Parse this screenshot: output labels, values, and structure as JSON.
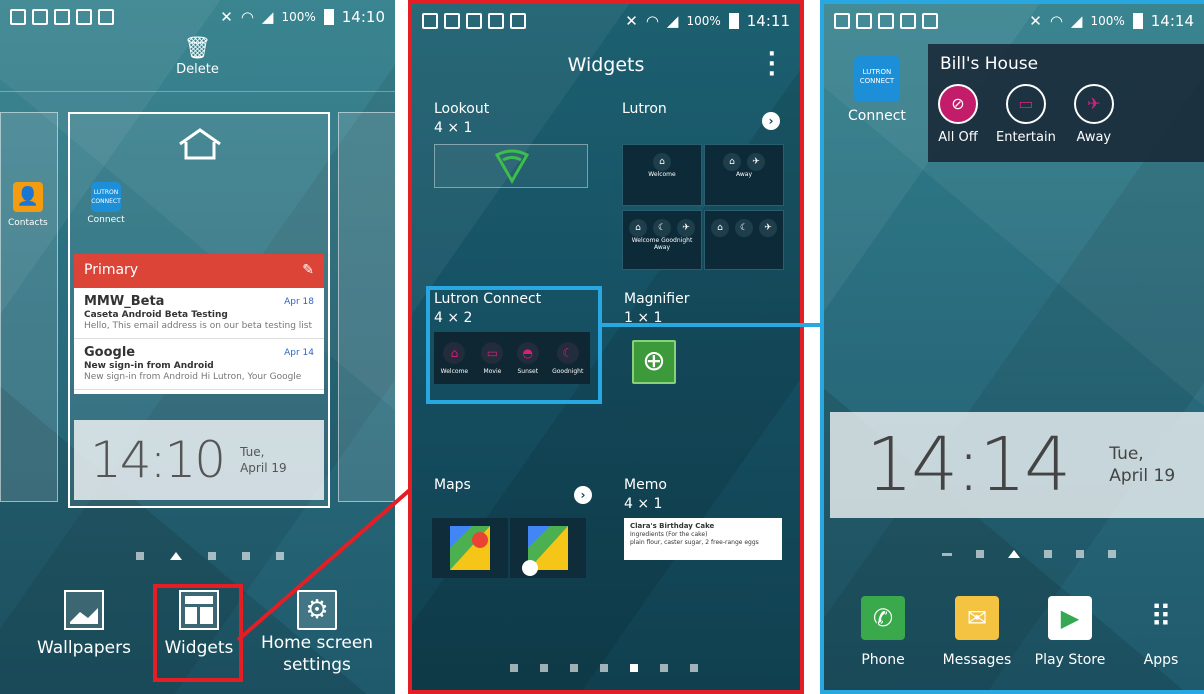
{
  "screen1": {
    "status_time": "14:10",
    "battery": "100%",
    "delete_label": "Delete",
    "contacts_label": "Contacts",
    "connect_label": "Connect",
    "lutron_icon_text": "LUTRON CONNECT",
    "gmail": {
      "header": "Primary",
      "items": [
        {
          "from": "MMW_Beta",
          "date": "Apr 18",
          "subject": "Caseta Android Beta Testing",
          "snippet": "Hello, This email address is on our beta testing list"
        },
        {
          "from": "Google",
          "date": "Apr 14",
          "subject": "New sign-in from Android",
          "snippet": "New sign-in from Android Hi Lutron, Your Google"
        }
      ]
    },
    "clock_time": "14:10",
    "clock_day": "Tue,",
    "clock_date": "April 19",
    "bottom": {
      "wallpapers": "Wallpapers",
      "widgets": "Widgets",
      "home_settings_line1": "Home screen",
      "home_settings_line2": "settings"
    }
  },
  "screen2": {
    "status_time": "14:11",
    "battery": "100%",
    "title": "Widgets",
    "widgets": [
      {
        "name": "Lookout",
        "size": "4 × 1"
      },
      {
        "name": "Lutron",
        "size": ""
      },
      {
        "name": "Lutron Connect",
        "size": "4 × 2"
      },
      {
        "name": "Magnifier",
        "size": "1 × 1"
      },
      {
        "name": "Maps",
        "size": ""
      },
      {
        "name": "Memo",
        "size": "4 × 1"
      }
    ],
    "lutron_preview_labels": [
      "Welcome",
      "Away",
      "Welcome",
      "Goodnight",
      "Away"
    ],
    "lutron_connect_buttons": [
      "Welcome",
      "Movie",
      "Sunset",
      "Goodnight"
    ],
    "memo_title": "Clara's Birthday Cake",
    "memo_line1": "Ingredients (For the cake)",
    "memo_line2": "plain flour, caster sugar, 2 free-range eggs"
  },
  "screen3": {
    "status_time": "14:14",
    "battery": "100%",
    "connect_label": "Connect",
    "lutron_icon_text": "LUTRON CONNECT",
    "widget_title": "Bill's House",
    "scenes": [
      "All Off",
      "Entertain",
      "Away"
    ],
    "clock_time": "14:14",
    "clock_day": "Tue,",
    "clock_date": "April 19",
    "dock": [
      "Phone",
      "Messages",
      "Play Store",
      "Apps"
    ]
  },
  "colors": {
    "highlight_red": "#e31e24",
    "highlight_blue": "#29a7e1",
    "lutron_magenta": "#c21c6a"
  }
}
